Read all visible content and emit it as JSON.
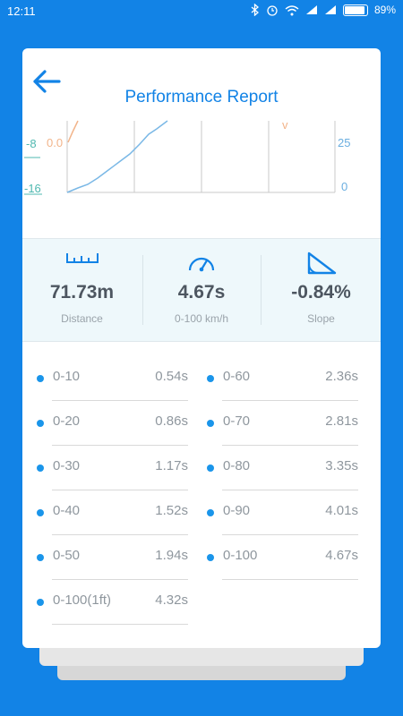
{
  "status_bar": {
    "time": "12:11",
    "battery": "89%"
  },
  "header": {
    "title": "Performance Report"
  },
  "chart": {
    "left_axis_ticks": [
      "-8",
      "-16"
    ],
    "left_orange_label": "0.0",
    "right_axis_ticks": [
      "25",
      "0"
    ],
    "orange_marker": "v",
    "colors": {
      "blue_series": "#7ab8e6",
      "orange_series": "#f2b48a",
      "left_ticks": "#4fb8b0",
      "right_ticks": "#6aaee0"
    }
  },
  "stats": {
    "distance": {
      "value": "71.73m",
      "label": "Distance",
      "icon": "ruler-icon"
    },
    "acceleration": {
      "value": "4.67s",
      "label": "0-100 km/h",
      "icon": "speedometer-icon"
    },
    "slope": {
      "value": "-0.84%",
      "label": "Slope",
      "icon": "slope-icon"
    }
  },
  "splits": [
    {
      "label": "0-10",
      "time": "0.54s"
    },
    {
      "label": "0-60",
      "time": "2.36s"
    },
    {
      "label": "0-20",
      "time": "0.86s"
    },
    {
      "label": "0-70",
      "time": "2.81s"
    },
    {
      "label": "0-30",
      "time": "1.17s"
    },
    {
      "label": "0-80",
      "time": "3.35s"
    },
    {
      "label": "0-40",
      "time": "1.52s"
    },
    {
      "label": "0-90",
      "time": "4.01s"
    },
    {
      "label": "0-50",
      "time": "1.94s"
    },
    {
      "label": "0-100",
      "time": "4.67s"
    },
    {
      "label": "0-100(1ft)",
      "time": "4.32s"
    }
  ],
  "colors": {
    "accent": "#1283e6",
    "dot": "#1a95ea"
  }
}
